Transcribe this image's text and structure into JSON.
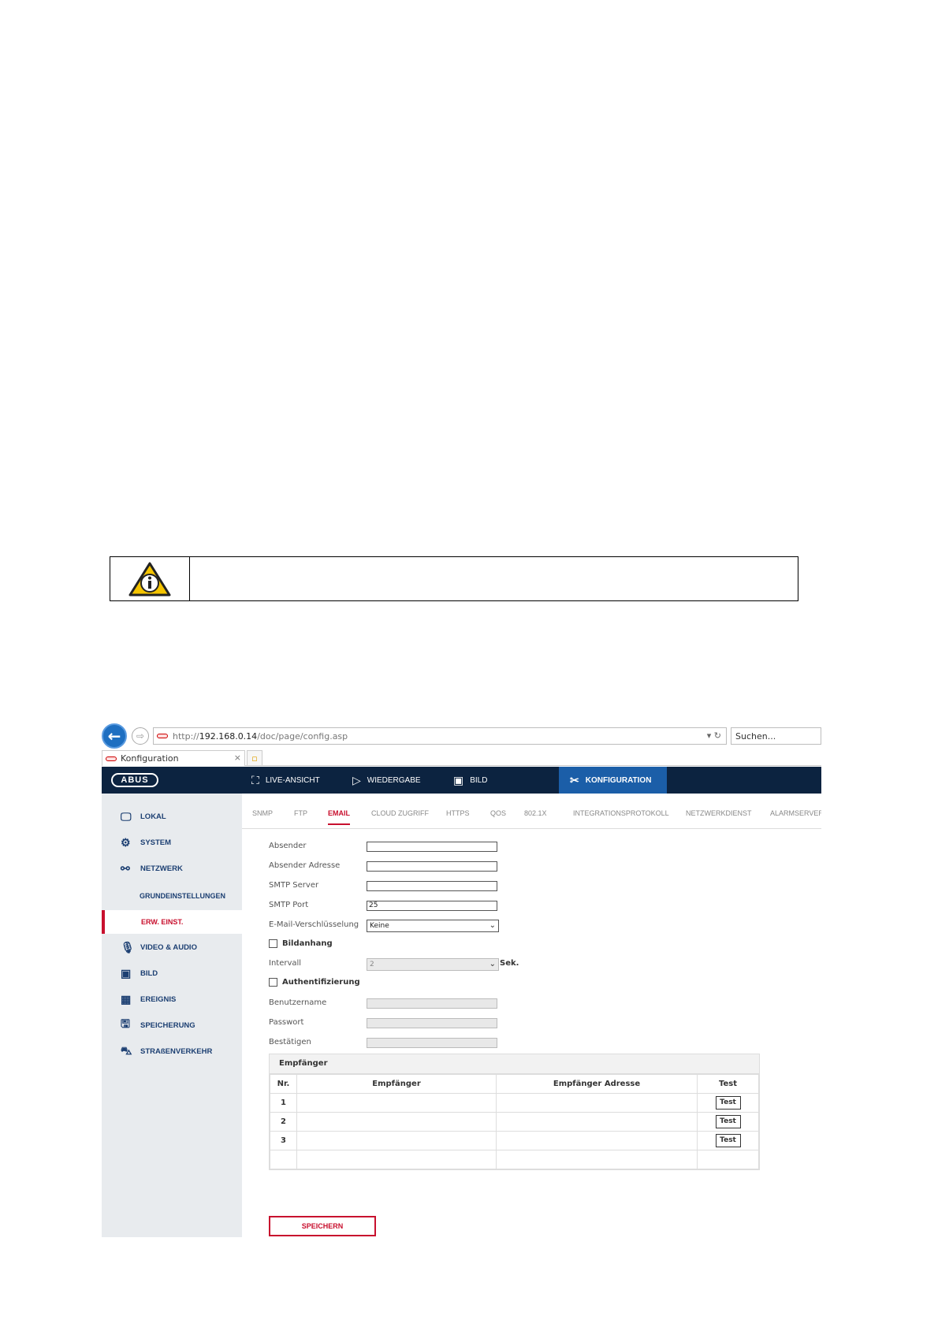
{
  "browser": {
    "url_prefix": "http://",
    "url_host": "192.168.0.14",
    "url_path": "/doc/page/config.asp",
    "search_placeholder": "Suchen...",
    "tab_title": "Konfiguration"
  },
  "header": {
    "logo": "ABUS",
    "nav": [
      {
        "label": "LIVE-ANSICHT",
        "icon": "live-view-icon"
      },
      {
        "label": "WIEDERGABE",
        "icon": "playback-icon"
      },
      {
        "label": "BILD",
        "icon": "image-icon"
      },
      {
        "label": "KONFIGURATION",
        "icon": "tools-icon",
        "active": true
      }
    ]
  },
  "sidebar": {
    "items": [
      {
        "label": "LOKAL",
        "icon": "monitor-icon"
      },
      {
        "label": "SYSTEM",
        "icon": "gear-icon"
      },
      {
        "label": "NETZWERK",
        "icon": "network-icon"
      },
      {
        "label": "GRUNDEINSTELLUNGEN",
        "sub": true
      },
      {
        "label": "ERW. EINST.",
        "sub": true,
        "active": true
      },
      {
        "label": "VIDEO & AUDIO",
        "icon": "microphone-icon"
      },
      {
        "label": "BILD",
        "icon": "image-icon"
      },
      {
        "label": "EREIGNIS",
        "icon": "calendar-icon"
      },
      {
        "label": "SPEICHERUNG",
        "icon": "storage-icon"
      },
      {
        "label": "STRAßENVERKEHR",
        "icon": "car-search-icon"
      }
    ]
  },
  "tabs": [
    "SNMP",
    "FTP",
    "EMAIL",
    "CLOUD ZUGRIFF",
    "HTTPS",
    "QOS",
    "802.1X",
    "INTEGRATIONSPROTOKOLL",
    "NETZWERKDIENST",
    "ALARMSERVER"
  ],
  "active_tab": "EMAIL",
  "form": {
    "absender_label": "Absender",
    "absender_value": "",
    "absender_adresse_label": "Absender Adresse",
    "absender_adresse_value": "",
    "smtp_server_label": "SMTP Server",
    "smtp_server_value": "",
    "smtp_port_label": "SMTP Port",
    "smtp_port_value": "25",
    "verschluesselung_label": "E-Mail-Verschlüsselung",
    "verschluesselung_value": "Keine",
    "bildanhang_label": "Bildanhang",
    "bildanhang_checked": false,
    "intervall_label": "Intervall",
    "intervall_value": "2",
    "intervall_unit": "Sek.",
    "auth_label": "Authentifizierung",
    "auth_checked": false,
    "benutzername_label": "Benutzername",
    "passwort_label": "Passwort",
    "bestaetigen_label": "Bestätigen"
  },
  "recipients": {
    "title": "Empfänger",
    "headers": [
      "Nr.",
      "Empfänger",
      "Empfänger Adresse",
      "Test"
    ],
    "rows": [
      {
        "nr": "1",
        "name": "",
        "address": "",
        "test": "Test"
      },
      {
        "nr": "2",
        "name": "",
        "address": "",
        "test": "Test"
      },
      {
        "nr": "3",
        "name": "",
        "address": "",
        "test": "Test"
      }
    ]
  },
  "save_label": "SPEICHERN",
  "colors": {
    "header_bg": "#0c2340",
    "active_nav": "#1b5ea8",
    "accent_red": "#c8102e",
    "sidebar_bg": "#e8ebee",
    "nav_text": "#1c3f72"
  }
}
